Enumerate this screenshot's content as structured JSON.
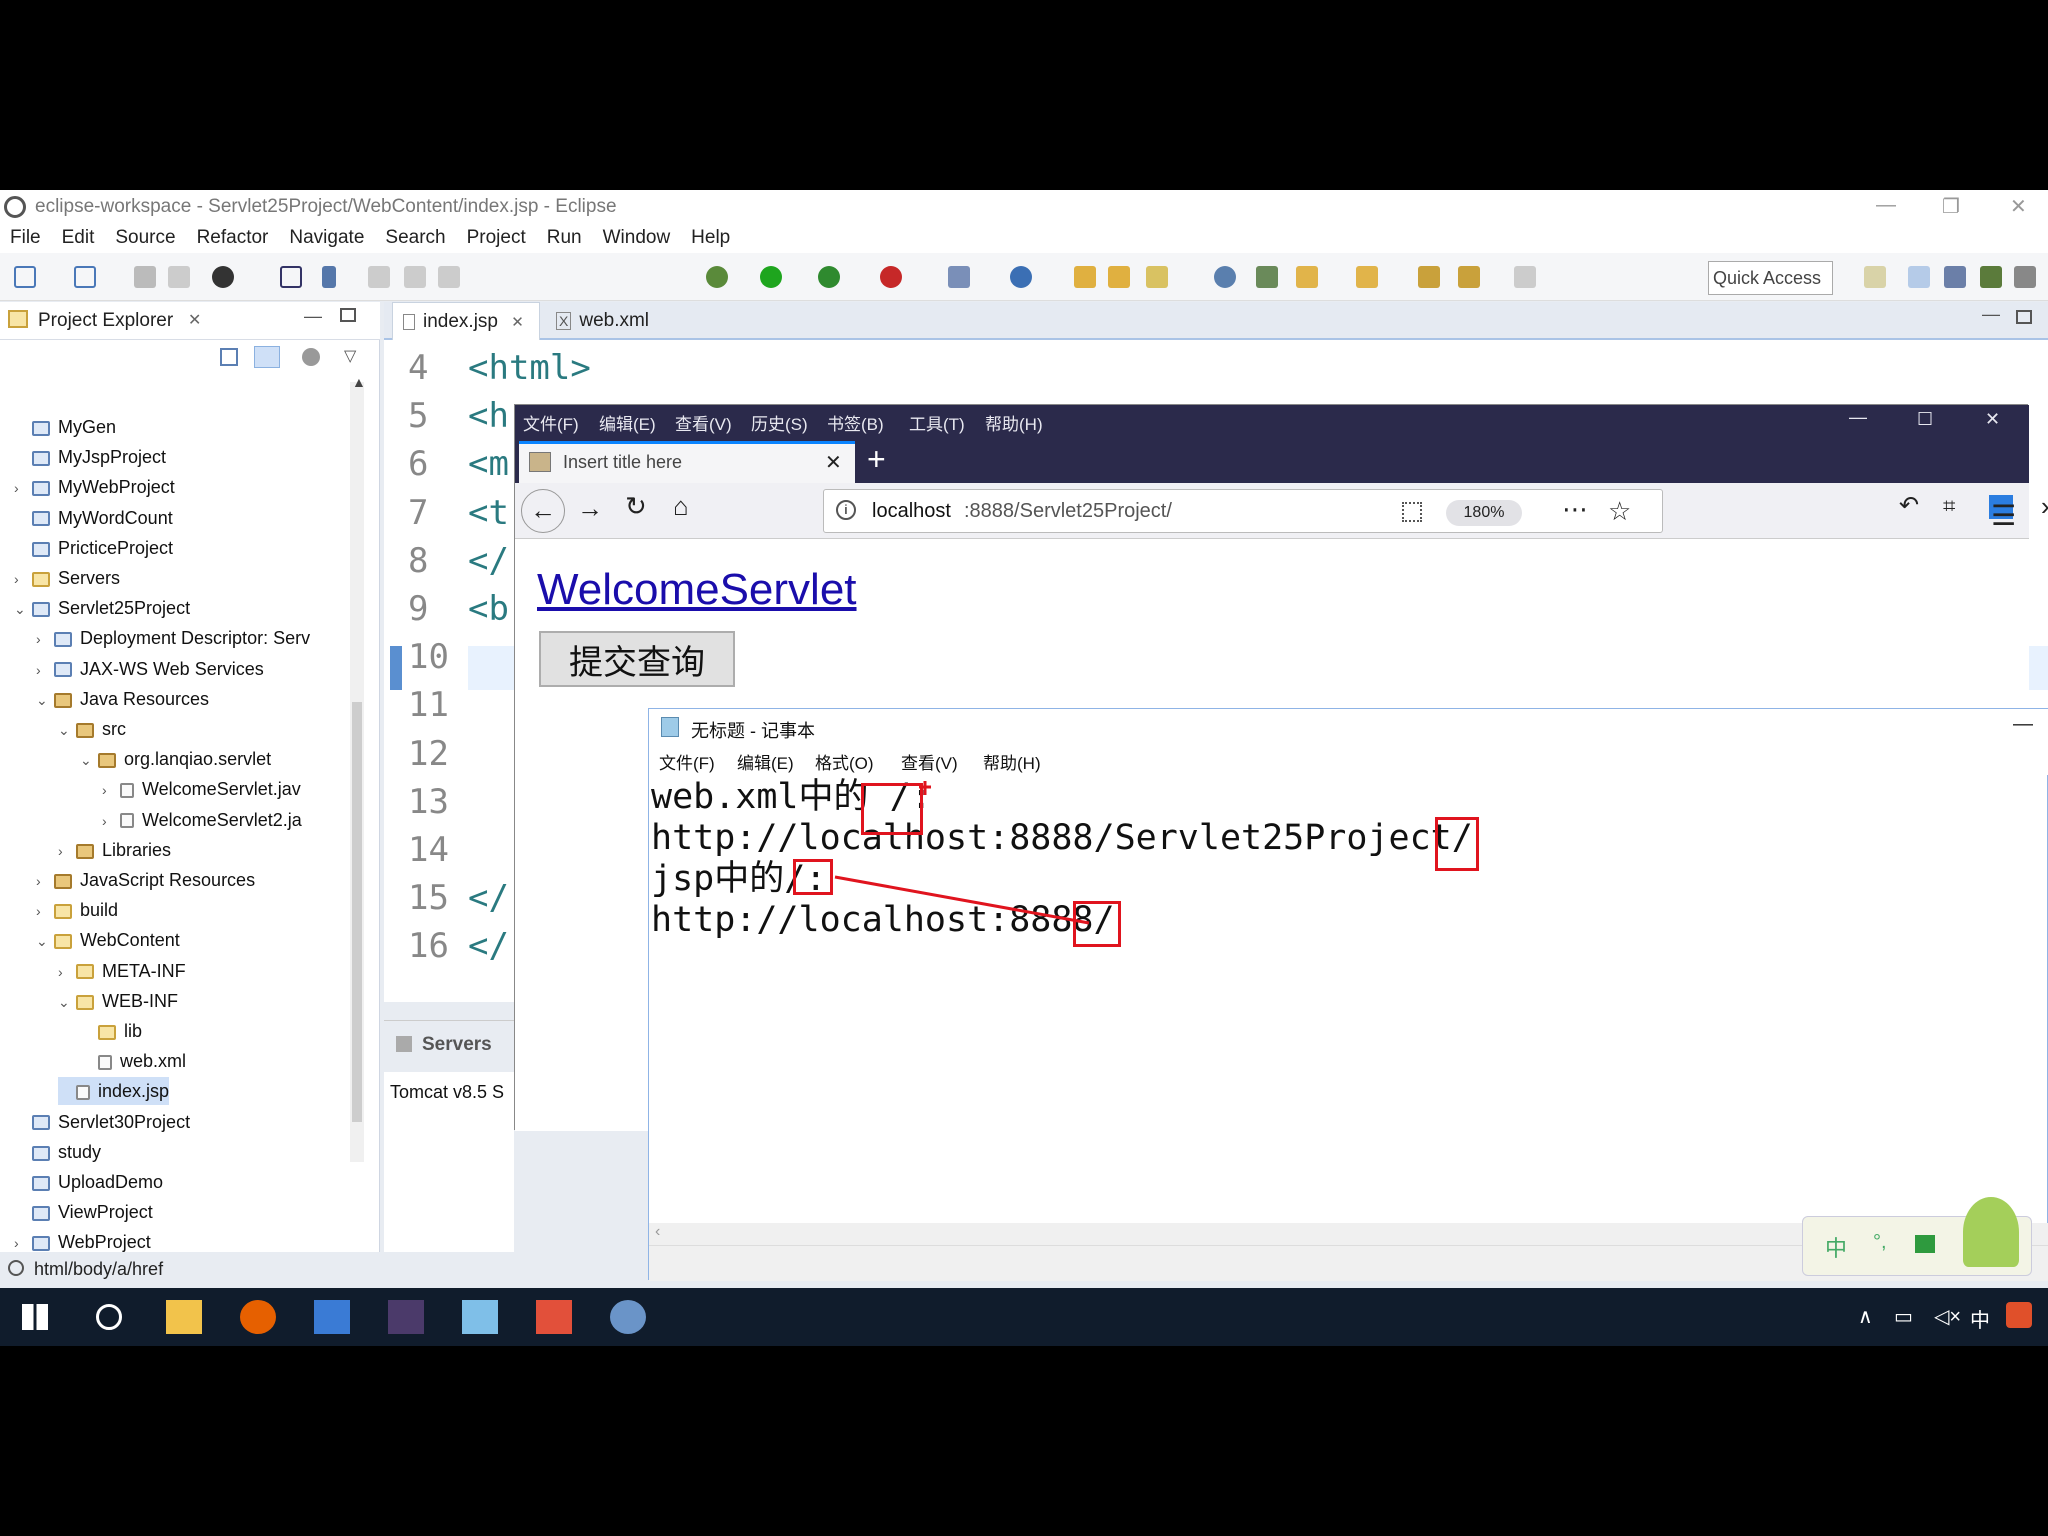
{
  "eclipse": {
    "title": "eclipse-workspace - Servlet25Project/WebContent/index.jsp - Eclipse",
    "menu": [
      "File",
      "Edit",
      "Source",
      "Refactor",
      "Navigate",
      "Search",
      "Project",
      "Run",
      "Window",
      "Help"
    ],
    "quick_access": "Quick Access",
    "project_explorer": {
      "title": "Project Explorer",
      "items": [
        {
          "label": "MyGen",
          "depth": 0,
          "chev": "",
          "type": "proj"
        },
        {
          "label": "MyJspProject",
          "depth": 0,
          "chev": "",
          "type": "proj"
        },
        {
          "label": "MyWebProject",
          "depth": 0,
          "chev": ">",
          "type": "proj"
        },
        {
          "label": "MyWordCount",
          "depth": 0,
          "chev": "",
          "type": "proj"
        },
        {
          "label": "PricticeProject",
          "depth": 0,
          "chev": "",
          "type": "proj"
        },
        {
          "label": "Servers",
          "depth": 0,
          "chev": ">",
          "type": "folder"
        },
        {
          "label": "Servlet25Project",
          "depth": 0,
          "chev": "v",
          "type": "proj"
        },
        {
          "label": "Deployment Descriptor: Serv",
          "depth": 1,
          "chev": ">",
          "type": "proj"
        },
        {
          "label": "JAX-WS Web Services",
          "depth": 1,
          "chev": ">",
          "type": "proj"
        },
        {
          "label": "Java Resources",
          "depth": 1,
          "chev": "v",
          "type": "pkg"
        },
        {
          "label": "src",
          "depth": 2,
          "chev": "v",
          "type": "pkg"
        },
        {
          "label": "org.lanqiao.servlet",
          "depth": 3,
          "chev": "v",
          "type": "pkg"
        },
        {
          "label": "WelcomeServlet.jav",
          "depth": 4,
          "chev": ">",
          "type": "file"
        },
        {
          "label": "WelcomeServlet2.ja",
          "depth": 4,
          "chev": ">",
          "type": "file"
        },
        {
          "label": "Libraries",
          "depth": 2,
          "chev": ">",
          "type": "pkg"
        },
        {
          "label": "JavaScript Resources",
          "depth": 1,
          "chev": ">",
          "type": "pkg"
        },
        {
          "label": "build",
          "depth": 1,
          "chev": ">",
          "type": "folder"
        },
        {
          "label": "WebContent",
          "depth": 1,
          "chev": "v",
          "type": "folder"
        },
        {
          "label": "META-INF",
          "depth": 2,
          "chev": ">",
          "type": "folder"
        },
        {
          "label": "WEB-INF",
          "depth": 2,
          "chev": "v",
          "type": "folder"
        },
        {
          "label": "lib",
          "depth": 3,
          "chev": "",
          "type": "folder"
        },
        {
          "label": "web.xml",
          "depth": 3,
          "chev": "",
          "type": "file"
        },
        {
          "label": "index.jsp",
          "depth": 2,
          "chev": "",
          "type": "file",
          "selected": true
        },
        {
          "label": "Servlet30Project",
          "depth": 0,
          "chev": "",
          "type": "proj"
        },
        {
          "label": "study",
          "depth": 0,
          "chev": "",
          "type": "proj"
        },
        {
          "label": "UploadDemo",
          "depth": 0,
          "chev": "",
          "type": "proj"
        },
        {
          "label": "ViewProject",
          "depth": 0,
          "chev": "",
          "type": "proj"
        },
        {
          "label": "WebProject",
          "depth": 0,
          "chev": ">",
          "type": "proj"
        }
      ]
    },
    "editor_tabs": [
      "index.jsp",
      "web.xml"
    ],
    "code_lines": [
      {
        "no": "4",
        "text": "<html>"
      },
      {
        "no": "5",
        "text": "<h"
      },
      {
        "no": "6",
        "text": "<m"
      },
      {
        "no": "7",
        "text": "<t"
      },
      {
        "no": "8",
        "text": "</"
      },
      {
        "no": "9",
        "text": "<b"
      },
      {
        "no": "10",
        "text": ""
      },
      {
        "no": "11",
        "text": ""
      },
      {
        "no": "12",
        "text": ""
      },
      {
        "no": "13",
        "text": ""
      },
      {
        "no": "14",
        "text": ""
      },
      {
        "no": "15",
        "text": "</"
      },
      {
        "no": "16",
        "text": "</"
      }
    ],
    "servers_tab": "Servers",
    "server_row": "Tomcat v8.5 S",
    "status_path": "html/body/a/href"
  },
  "firefox": {
    "menu": [
      "文件(F)",
      "编辑(E)",
      "查看(V)",
      "历史(S)",
      "书签(B)",
      "工具(T)",
      "帮助(H)"
    ],
    "tab_title": "Insert title here",
    "url_host": "localhost",
    "url_rest": ":8888/Servlet25Project/",
    "zoom": "180%",
    "link_text": "WelcomeServlet",
    "button_text": "提交查询"
  },
  "notepad": {
    "title": "无标题 - 记事本",
    "menu": [
      "文件(F)",
      "编辑(E)",
      "格式(O)",
      "查看(V)",
      "帮助(H)"
    ],
    "lines": [
      "web.xml中的 /:",
      "http://localhost:8888/Servlet25Project/",
      "jsp中的/:",
      "http://localhost:8888/"
    ]
  },
  "ime": {
    "label": "中"
  },
  "taskbar": {
    "tray_lang": "中"
  },
  "colors": {
    "accent": "#0a84ff",
    "annotation_red": "#e0141e",
    "taskbar": "#101c2c"
  }
}
